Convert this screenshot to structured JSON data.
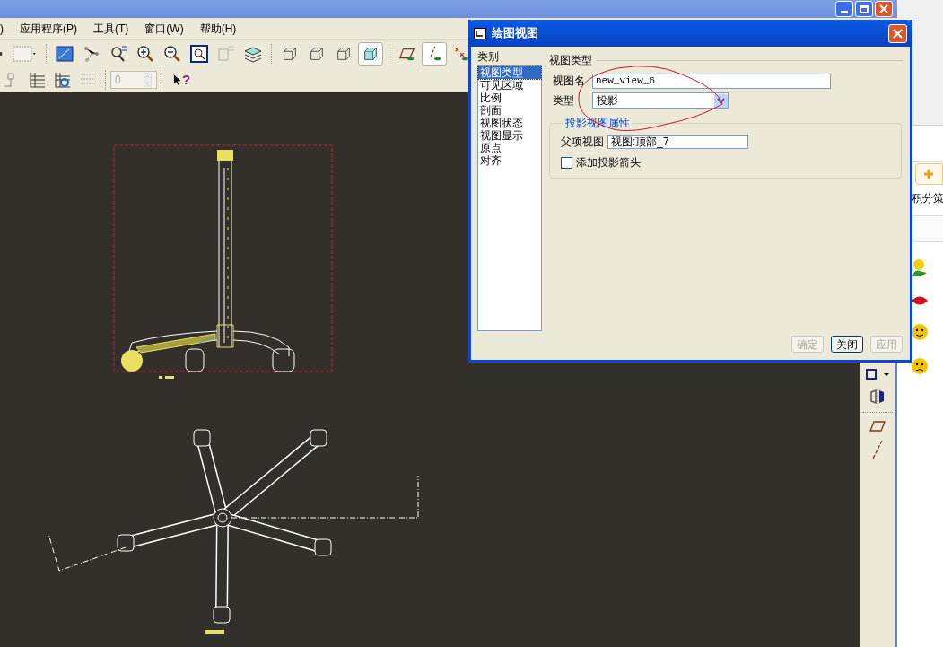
{
  "menu_bar": {
    "items": [
      ")",
      "应用程序(P)",
      "工具(T)",
      "窗口(W)",
      "帮助(H)"
    ]
  },
  "toolbar": {
    "view_buttons": [
      {
        "selected": false
      },
      {
        "selected": false
      },
      {
        "selected": false
      },
      {
        "selected": true
      }
    ],
    "display_buttons": [
      {
        "selected": false
      },
      {
        "selected": true
      },
      {
        "selected": false
      }
    ],
    "spin_value": "0",
    "help_glyph": "?"
  },
  "dialog": {
    "title": "绘图视图",
    "category_label": "类别",
    "categories": [
      {
        "label": "视图类型",
        "selected": true
      },
      {
        "label": "可见区域",
        "selected": false
      },
      {
        "label": "比例",
        "selected": false
      },
      {
        "label": "剖面",
        "selected": false
      },
      {
        "label": "视图状态",
        "selected": false
      },
      {
        "label": "视图显示",
        "selected": false
      },
      {
        "label": "原点",
        "selected": false
      },
      {
        "label": "对齐",
        "selected": false
      }
    ],
    "section_title": "视图类型",
    "view_name": {
      "label": "视图名",
      "value": "new_view_6"
    },
    "view_type": {
      "label": "类型",
      "value": "投影"
    },
    "group": {
      "title": "投影视图属性",
      "parent_view": {
        "label": "父项视图",
        "value": "视图:顶部_7"
      },
      "arrow_checkbox": {
        "label": "添加投影箭头",
        "checked": false
      }
    },
    "buttons": [
      {
        "label": "确定",
        "disabled": true
      },
      {
        "label": "关闭",
        "disabled": false
      },
      {
        "label": "应用",
        "disabled": true
      }
    ]
  },
  "side_panel": {
    "text": "积分策"
  }
}
